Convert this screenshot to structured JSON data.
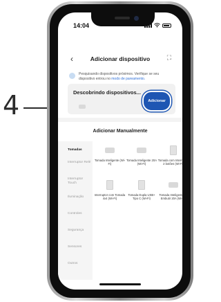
{
  "callout": {
    "number": "4"
  },
  "status_bar": {
    "time": "14:04"
  },
  "nav": {
    "back": "‹",
    "title": "Adicionar dispositivo",
    "scan": "⛶"
  },
  "notice": {
    "text": "Pesquisando dispositivos próximos. Verifique se seu dispositivo entrou no ",
    "link": "modo de pareamento."
  },
  "discover": {
    "label": "Descobrindo dispositivos...",
    "add_button": "Adicionar"
  },
  "manual": {
    "title": "Adicionar Manualmente"
  },
  "categories": [
    "Tomadas",
    "Interruptor Relé",
    "Interruptor Touch",
    "Iluminação",
    "Controles",
    "Segurança",
    "Sensores",
    "Outros"
  ],
  "devices": [
    "Tomada Inteligente (Wi-Fi)",
    "Tomada Inteligente 20A (Wi-Fi)",
    "Tomada com Interruptor 2 botões (Wi-Fi)",
    "Interruptor com Tomada 4x4 (Wi-Fi)",
    "Tomada Dupla USB+ Tipo C (Wi-Fi)",
    "Tomada Inteligente de Embutir 20A (Wi-Fi)"
  ]
}
